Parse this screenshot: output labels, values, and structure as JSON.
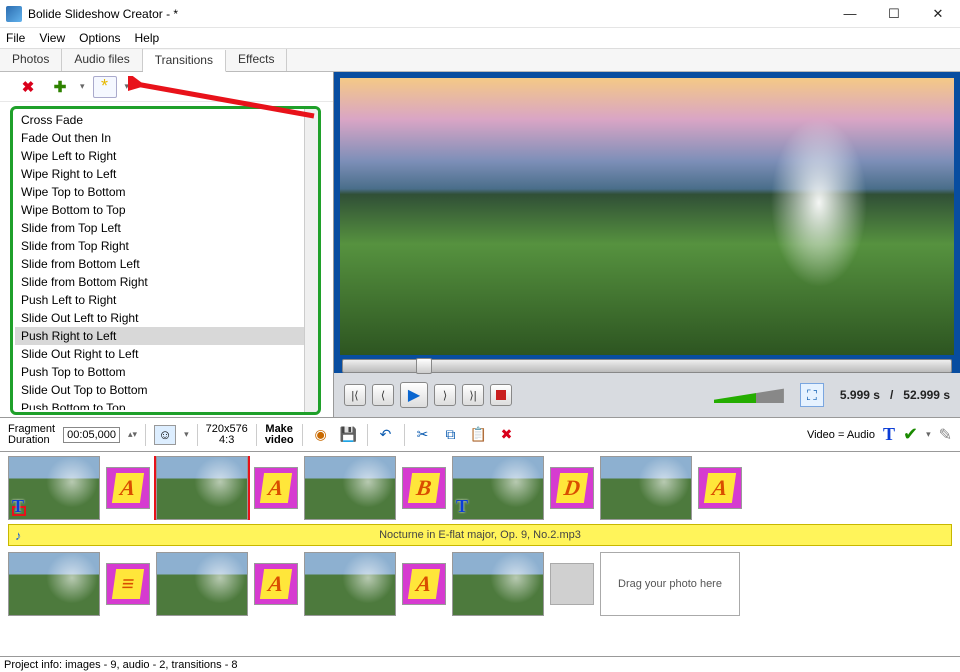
{
  "window": {
    "title": "Bolide Slideshow Creator - *",
    "min": "—",
    "max": "☐",
    "close": "✕"
  },
  "menu": {
    "items": [
      "File",
      "View",
      "Options",
      "Help"
    ]
  },
  "tabs": {
    "items": [
      "Photos",
      "Audio files",
      "Transitions",
      "Effects"
    ],
    "active": "Transitions"
  },
  "transitions": {
    "selected": "Push Right to Left",
    "list": [
      "Cross Fade",
      "Fade Out then In",
      "Wipe Left to Right",
      "Wipe Right to Left",
      "Wipe Top to Bottom",
      "Wipe Bottom to Top",
      "Slide from Top Left",
      "Slide from Top Right",
      "Slide from Bottom Left",
      "Slide from Bottom Right",
      "Push Left to Right",
      "Slide Out Left to Right",
      "Push Right to Left",
      "Slide Out Right to Left",
      "Push Top to Bottom",
      "Slide Out Top to Bottom",
      "Push Bottom to Top"
    ]
  },
  "player": {
    "time_current": "5.999 s",
    "time_total": "52.999 s",
    "time_sep": "/"
  },
  "midbar": {
    "frag_label_1": "Fragment",
    "frag_label_2": "Duration",
    "frag_value": "00:05,000",
    "resolution": "720x576",
    "aspect": "4:3",
    "make_1": "Make",
    "make_2": "video",
    "va_label": "Video = Audio",
    "t_label": "T"
  },
  "timeline": {
    "audio_label": "Nocturne in E-flat major, Op. 9, No.2.mp3",
    "drop_label": "Drag your photo here",
    "row1_trans": [
      "A",
      "A",
      "B",
      "D",
      "A"
    ],
    "row2_trans": [
      "≡",
      "A",
      "A"
    ]
  },
  "status": {
    "text": "Project info: images - 9, audio - 2, transitions - 8"
  }
}
